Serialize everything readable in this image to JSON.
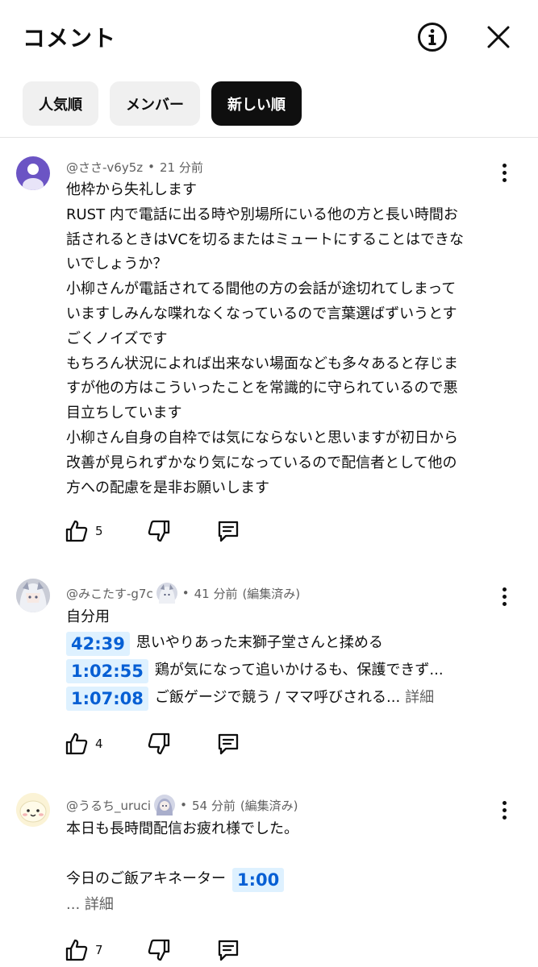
{
  "header": {
    "title": "コメント",
    "info_icon": "info-icon",
    "close_icon": "close-icon"
  },
  "chips": [
    {
      "label": "人気順",
      "active": false
    },
    {
      "label": "メンバー",
      "active": false
    },
    {
      "label": "新しい順",
      "active": true
    }
  ],
  "comments": [
    {
      "author": "@ささ-v6y5z",
      "time": "21 分前",
      "edited": "",
      "lines": [
        "他枠から失礼します",
        "RUST 内で電話に出る時や別場所にいる他の方と長い時間お",
        "話されるときはVCを切るまたはミュートにすることはできな",
        "いでしょうか？",
        "小柳さんが電話されてる間他の方の会話が途切れてしまって",
        "いますしみんな喋れなくなっているので言葉選ばずいうとす",
        "ごくノイズです",
        "もちろん状況によれば出来ない場面なども多々あると存じま",
        "すが他の方はこういったことを常識的に守られているので悪",
        "目立ちしています",
        "小柳さん自身の自枠では気にならないと思いますが初日から",
        "改善が見られずかなり気になっているので配信者として他の",
        "方への配慮を是非お願いします"
      ],
      "likes": "5"
    },
    {
      "author": "@みこたす-g7c",
      "time": "41 分前",
      "edited": "(編集済み)",
      "intro": "自分用",
      "timestamps": [
        {
          "time": "42:39",
          "text": "思いやりあった末獅子堂さんと揉める"
        },
        {
          "time": "1:02:55",
          "text": "鶏が気になって追いかけるも、保護できず..."
        },
        {
          "time": "1:07:08",
          "text": "ご飯ゲージで競う / ママ呼びされる...",
          "more": "詳細"
        }
      ],
      "likes": "4"
    },
    {
      "author": "@うるち_uruci",
      "time": "54 分前",
      "edited": "(編集済み)",
      "line1": "本日も長時間配信お疲れ様でした。",
      "line2": "今日のご飯アキネーター",
      "timestamp": "1:00",
      "more": "... 詳細",
      "likes": "7"
    }
  ],
  "colors": {
    "accent_link": "#065fd4",
    "timestamp_bg": "#def1ff",
    "avatar_purple": "#6b54c4"
  }
}
